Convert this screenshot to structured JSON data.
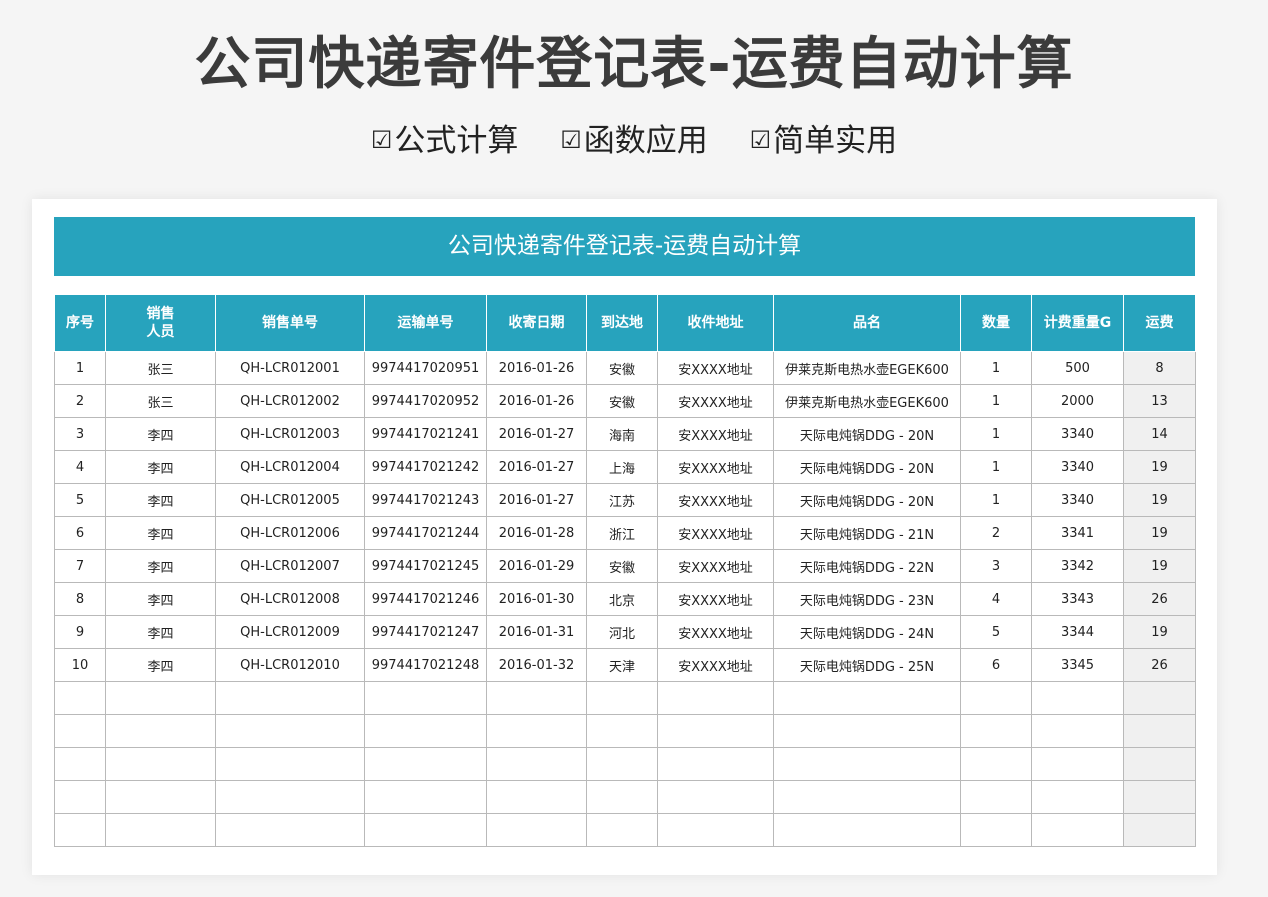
{
  "page": {
    "title": "公司快递寄件登记表-运费自动计算",
    "features": [
      "公式计算",
      "函数应用",
      "简单实用"
    ],
    "check_glyph": "☑"
  },
  "sheet": {
    "title": "公司快递寄件登记表-运费自动计算",
    "headers": {
      "seq": "序号",
      "seller_line1": "销售",
      "seller_line2": "人员",
      "order_no": "销售单号",
      "tracking_no": "运输单号",
      "date": "收寄日期",
      "dest": "到达地",
      "address": "收件地址",
      "product": "品名",
      "qty": "数量",
      "weight": "计费重量G",
      "fee": "运费"
    },
    "rows": [
      {
        "seq": "1",
        "seller": "张三",
        "order_no": "QH-LCR012001",
        "tracking_no": "9974417020951",
        "date": "2016-01-26",
        "dest": "安徽",
        "address": "安XXXX地址",
        "product": "伊莱克斯电热水壶EGEK600",
        "qty": "1",
        "weight": "500",
        "fee": "8"
      },
      {
        "seq": "2",
        "seller": "张三",
        "order_no": "QH-LCR012002",
        "tracking_no": "9974417020952",
        "date": "2016-01-26",
        "dest": "安徽",
        "address": "安XXXX地址",
        "product": "伊莱克斯电热水壶EGEK600",
        "qty": "1",
        "weight": "2000",
        "fee": "13"
      },
      {
        "seq": "3",
        "seller": "李四",
        "order_no": "QH-LCR012003",
        "tracking_no": "9974417021241",
        "date": "2016-01-27",
        "dest": "海南",
        "address": "安XXXX地址",
        "product": "天际电炖锅DDG - 20N",
        "qty": "1",
        "weight": "3340",
        "fee": "14"
      },
      {
        "seq": "4",
        "seller": "李四",
        "order_no": "QH-LCR012004",
        "tracking_no": "9974417021242",
        "date": "2016-01-27",
        "dest": "上海",
        "address": "安XXXX地址",
        "product": "天际电炖锅DDG - 20N",
        "qty": "1",
        "weight": "3340",
        "fee": "19"
      },
      {
        "seq": "5",
        "seller": "李四",
        "order_no": "QH-LCR012005",
        "tracking_no": "9974417021243",
        "date": "2016-01-27",
        "dest": "江苏",
        "address": "安XXXX地址",
        "product": "天际电炖锅DDG - 20N",
        "qty": "1",
        "weight": "3340",
        "fee": "19"
      },
      {
        "seq": "6",
        "seller": "李四",
        "order_no": "QH-LCR012006",
        "tracking_no": "9974417021244",
        "date": "2016-01-28",
        "dest": "浙江",
        "address": "安XXXX地址",
        "product": "天际电炖锅DDG - 21N",
        "qty": "2",
        "weight": "3341",
        "fee": "19"
      },
      {
        "seq": "7",
        "seller": "李四",
        "order_no": "QH-LCR012007",
        "tracking_no": "9974417021245",
        "date": "2016-01-29",
        "dest": "安徽",
        "address": "安XXXX地址",
        "product": "天际电炖锅DDG - 22N",
        "qty": "3",
        "weight": "3342",
        "fee": "19"
      },
      {
        "seq": "8",
        "seller": "李四",
        "order_no": "QH-LCR012008",
        "tracking_no": "9974417021246",
        "date": "2016-01-30",
        "dest": "北京",
        "address": "安XXXX地址",
        "product": "天际电炖锅DDG - 23N",
        "qty": "4",
        "weight": "3343",
        "fee": "26"
      },
      {
        "seq": "9",
        "seller": "李四",
        "order_no": "QH-LCR012009",
        "tracking_no": "9974417021247",
        "date": "2016-01-31",
        "dest": "河北",
        "address": "安XXXX地址",
        "product": "天际电炖锅DDG - 24N",
        "qty": "5",
        "weight": "3344",
        "fee": "19"
      },
      {
        "seq": "10",
        "seller": "李四",
        "order_no": "QH-LCR012010",
        "tracking_no": "9974417021248",
        "date": "2016-01-32",
        "dest": "天津",
        "address": "安XXXX地址",
        "product": "天际电炖锅DDG - 25N",
        "qty": "6",
        "weight": "3345",
        "fee": "26"
      }
    ],
    "empty_rows": 5
  },
  "colors": {
    "accent": "#27a3bd",
    "fee_cell": "#f0f0f0"
  }
}
